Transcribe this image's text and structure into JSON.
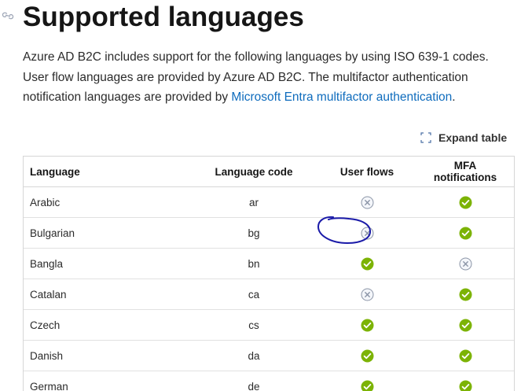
{
  "page": {
    "title": "Supported languages",
    "intro_text": "Azure AD B2C includes support for the following languages by using ISO 639-1 codes. User flow languages are provided by Azure AD B2C. The multifactor authentication notification languages are provided by ",
    "intro_link": "Microsoft Entra multifactor authentication",
    "intro_end": "."
  },
  "expand": {
    "label": "Expand table",
    "icon": "expand-icon"
  },
  "table": {
    "headers": {
      "language": "Language",
      "code": "Language code",
      "user_flows": "User flows",
      "mfa": "MFA notifications"
    },
    "rows": [
      {
        "language": "Arabic",
        "code": "ar",
        "user_flows": false,
        "mfa": true
      },
      {
        "language": "Bulgarian",
        "code": "bg",
        "user_flows": false,
        "mfa": true
      },
      {
        "language": "Bangla",
        "code": "bn",
        "user_flows": true,
        "mfa": false
      },
      {
        "language": "Catalan",
        "code": "ca",
        "user_flows": false,
        "mfa": true
      },
      {
        "language": "Czech",
        "code": "cs",
        "user_flows": true,
        "mfa": true
      },
      {
        "language": "Danish",
        "code": "da",
        "user_flows": true,
        "mfa": true
      },
      {
        "language": "German",
        "code": "de",
        "user_flows": true,
        "mfa": true
      }
    ]
  },
  "colors": {
    "supported": "#7cb305",
    "unsupported": "#8a94a6",
    "link": "#0f6cbd",
    "annotation": "#1a1aa8"
  },
  "icons": {
    "supported": "check-circle-icon",
    "unsupported": "x-circle-icon"
  }
}
